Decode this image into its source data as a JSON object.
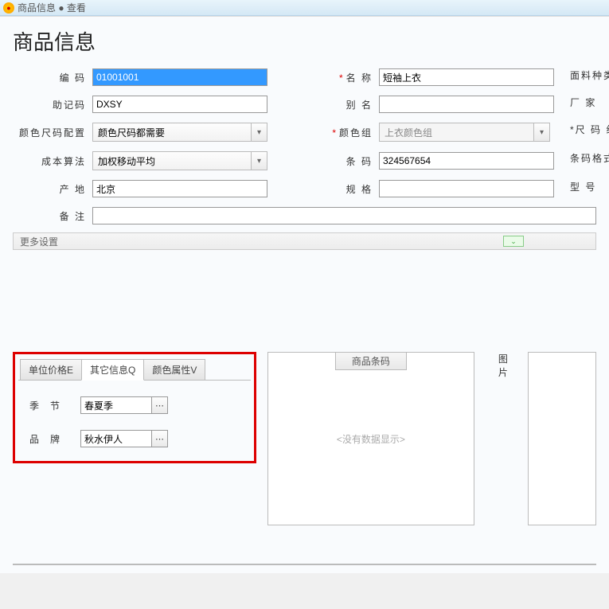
{
  "titlebar": {
    "text": "商品信息 ● 查看"
  },
  "page_title": "商品信息",
  "fields": {
    "code": {
      "label": "编  码",
      "value": "01001001"
    },
    "name": {
      "label": "名  称",
      "value": "短袖上衣"
    },
    "fabric": {
      "label": "面料种类"
    },
    "mnemonic": {
      "label": "助记码",
      "value": "DXSY"
    },
    "alias": {
      "label": "别  名",
      "value": ""
    },
    "factory": {
      "label": "厂    家"
    },
    "colorsize_config": {
      "label": "颜色尺码配置",
      "value": "颜色尺码都需要"
    },
    "color_group": {
      "label": "颜色组",
      "value": "上衣颜色组"
    },
    "size_group": {
      "label": "尺 码 组"
    },
    "cost_method": {
      "label": "成本算法",
      "value": "加权移动平均"
    },
    "barcode": {
      "label": "条  码",
      "value": "324567654"
    },
    "barcode_format": {
      "label": "条码格式"
    },
    "origin": {
      "label": "产  地",
      "value": "北京"
    },
    "spec": {
      "label": "规  格",
      "value": ""
    },
    "model": {
      "label": "型    号"
    },
    "remark": {
      "label": "备  注",
      "value": ""
    }
  },
  "more_settings": "更多设置",
  "tabs": {
    "unit_price": "单位价格E",
    "other_info": "其它信息Q",
    "color_attr": "颜色属性V"
  },
  "other_info_fields": {
    "season": {
      "label": "季节",
      "value": "春夏季"
    },
    "brand": {
      "label": "品牌",
      "value": "秋水伊人"
    }
  },
  "barcode_panel": {
    "title": "商品条码",
    "empty": "<没有数据显示>"
  },
  "image_panel": {
    "label": "图片"
  }
}
